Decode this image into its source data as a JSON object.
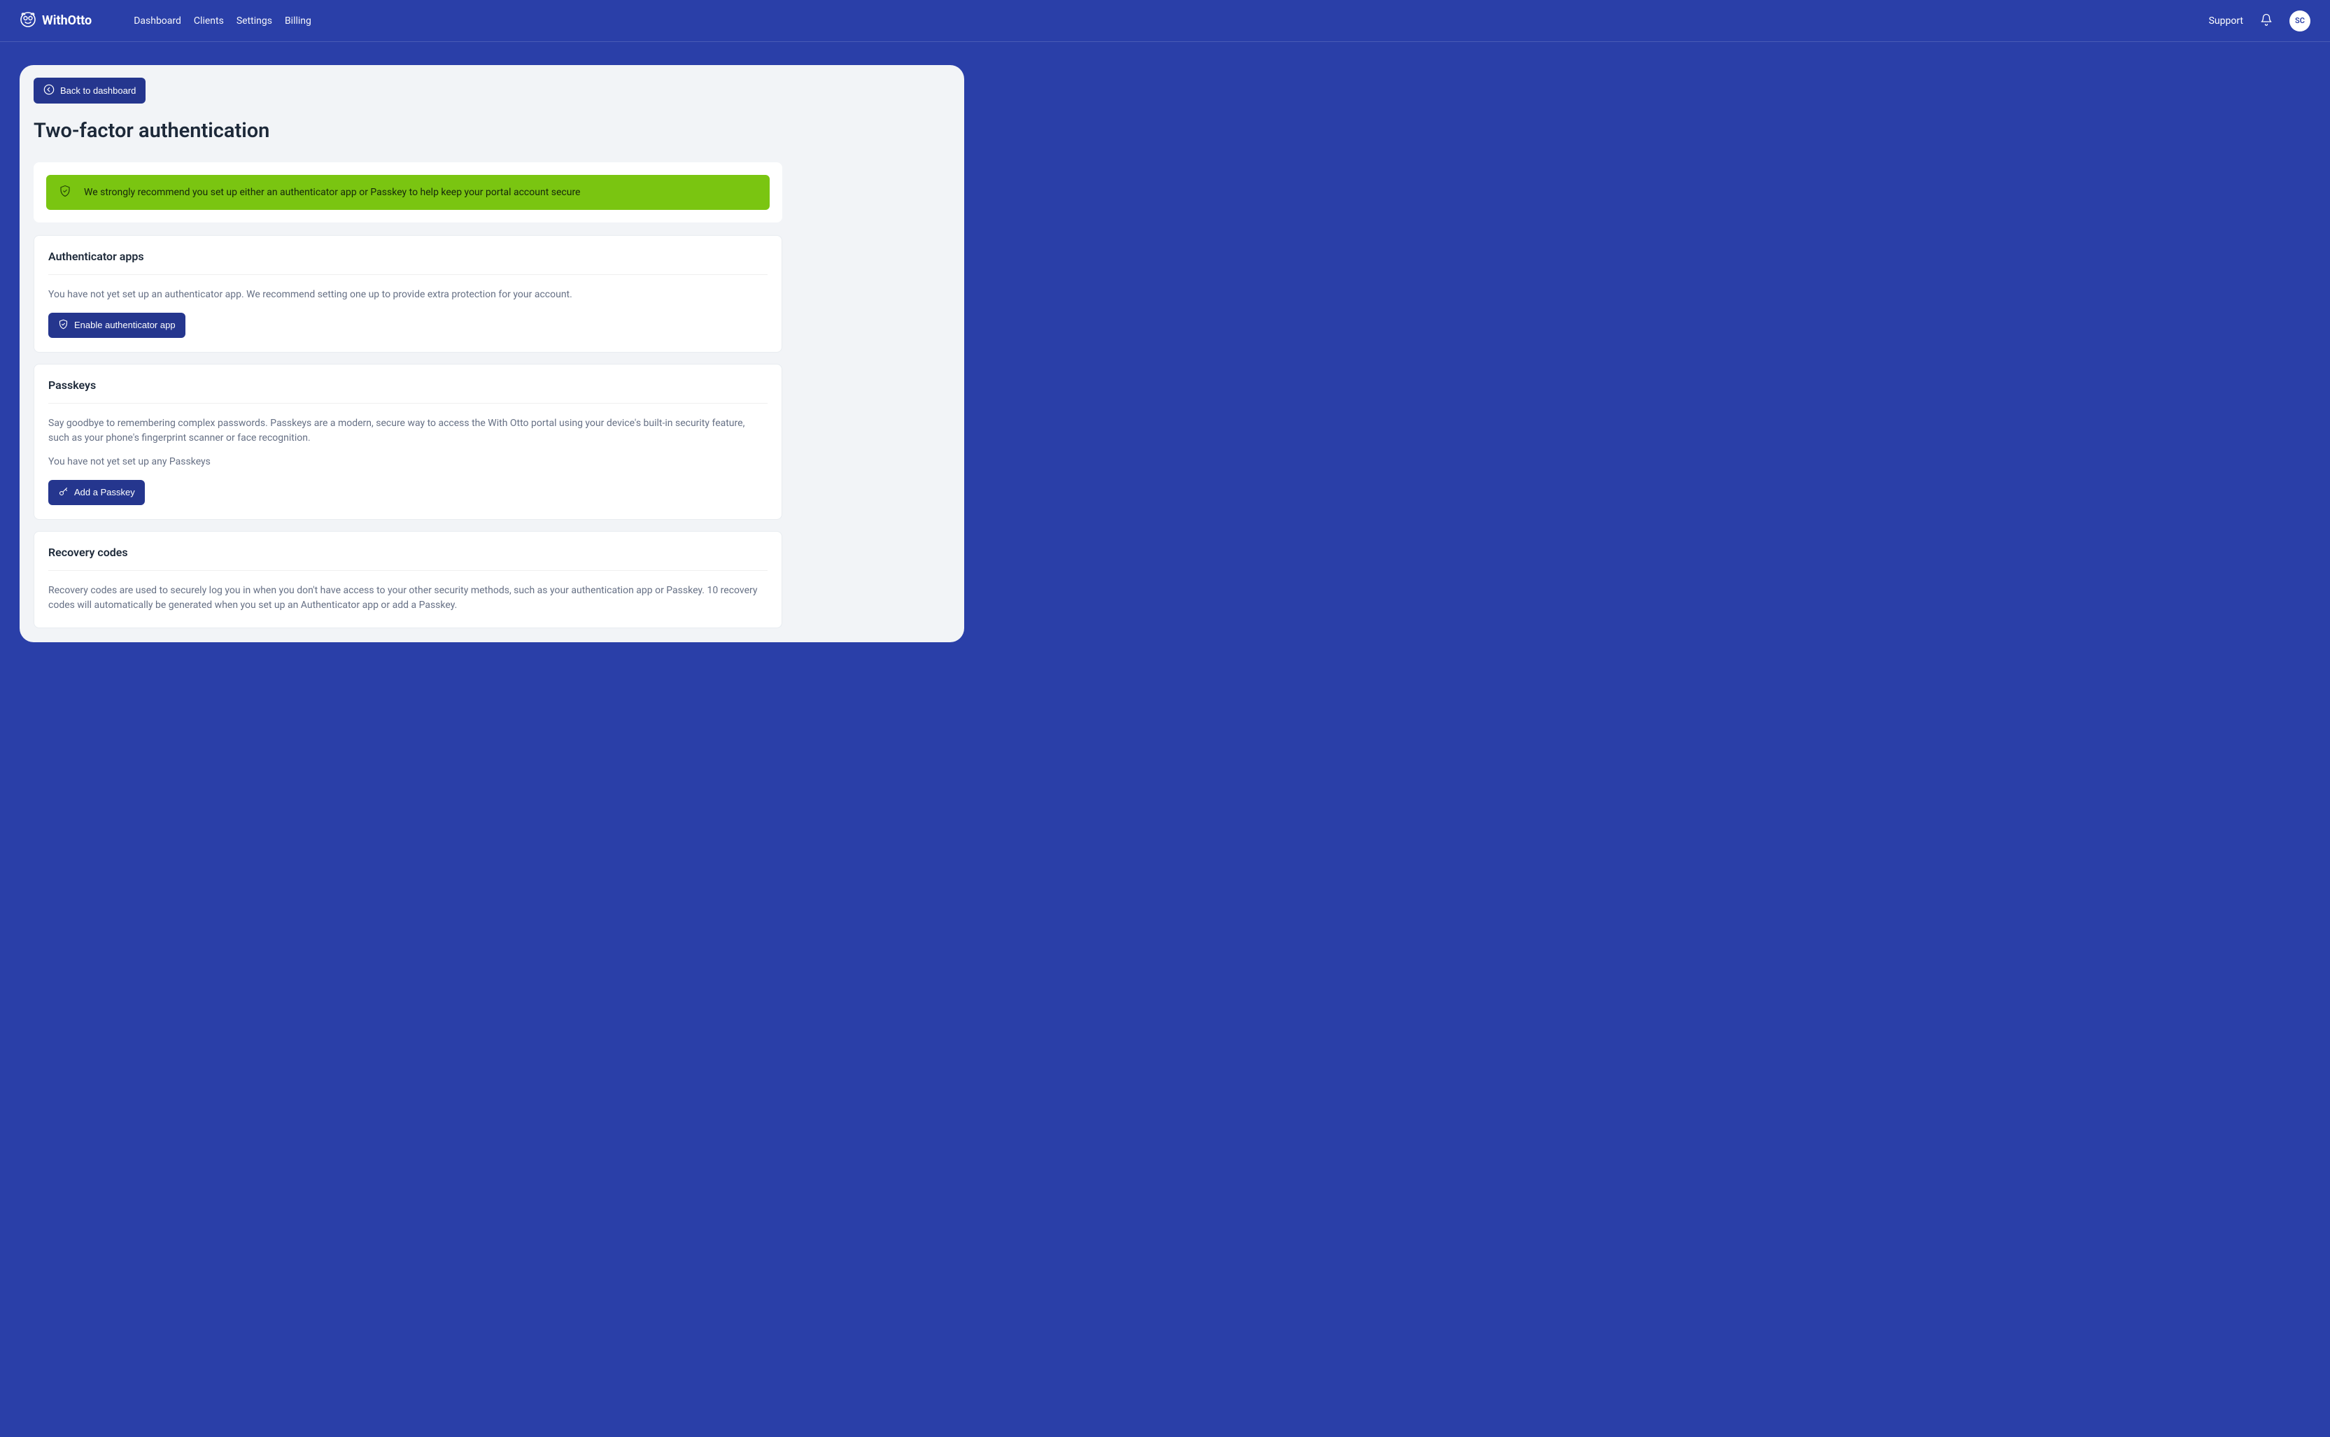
{
  "brand": {
    "text": "WithOtto"
  },
  "nav": {
    "items": [
      "Dashboard",
      "Clients",
      "Settings",
      "Billing"
    ],
    "support": "Support",
    "avatar_initials": "SC"
  },
  "page": {
    "back_label": "Back to dashboard",
    "title": "Two-factor authentication"
  },
  "alert": {
    "text": "We strongly recommend you set up either an authenticator app or Passkey to help keep your portal account secure"
  },
  "sections": {
    "authenticator": {
      "title": "Authenticator apps",
      "body": "You have not yet set up an authenticator app. We recommend setting one up to provide extra protection for your account.",
      "button": "Enable authenticator app"
    },
    "passkeys": {
      "title": "Passkeys",
      "body1": "Say goodbye to remembering complex passwords. Passkeys are a modern, secure way to access the With Otto portal using your device's built-in security feature, such as your phone's fingerprint scanner or face recognition.",
      "body2": "You have not yet set up any Passkeys",
      "button": "Add a Passkey"
    },
    "recovery": {
      "title": "Recovery codes",
      "body": "Recovery codes are used to securely log you in when you don't have access to your other security methods, such as your authentication app or Passkey. 10 recovery codes will automatically be generated when you set up an Authenticator app or add a Passkey."
    }
  }
}
